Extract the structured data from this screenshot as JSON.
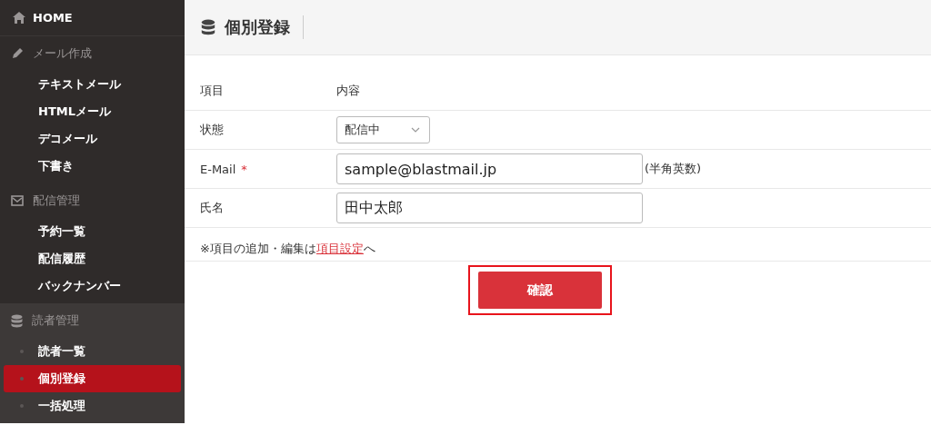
{
  "sidebar": {
    "home": {
      "label": "HOME"
    },
    "sections": [
      {
        "kind": "compose",
        "title": "メール作成",
        "active": false,
        "items": [
          {
            "label": "テキストメール",
            "selected": false
          },
          {
            "label": "HTMLメール",
            "selected": false
          },
          {
            "label": "デコメール",
            "selected": false
          },
          {
            "label": "下書き",
            "selected": false
          }
        ]
      },
      {
        "kind": "delivery",
        "title": "配信管理",
        "active": false,
        "items": [
          {
            "label": "予約一覧",
            "selected": false
          },
          {
            "label": "配信履歴",
            "selected": false
          },
          {
            "label": "バックナンバー",
            "selected": false
          }
        ]
      },
      {
        "kind": "readers",
        "title": "読者管理",
        "active": true,
        "items": [
          {
            "label": "読者一覧",
            "selected": false
          },
          {
            "label": "個別登録",
            "selected": true
          },
          {
            "label": "一括処理",
            "selected": false
          }
        ]
      }
    ]
  },
  "page": {
    "title": "個別登録"
  },
  "form": {
    "header": {
      "label": "項目",
      "value": "内容"
    },
    "fields": [
      {
        "kind": "select",
        "label": "状態",
        "value": "配信中"
      },
      {
        "kind": "text",
        "label": "E-Mail",
        "required_mark": "*",
        "value": "sample@blastmail.jp",
        "hint": "(半角英数)"
      },
      {
        "kind": "text",
        "label": "氏名",
        "value": "田中太郎"
      }
    ],
    "note": {
      "before": "※項目の追加・編集は",
      "link": "項目設定",
      "after": "へ"
    },
    "submit": {
      "label": "確認",
      "highlighted": true
    }
  }
}
